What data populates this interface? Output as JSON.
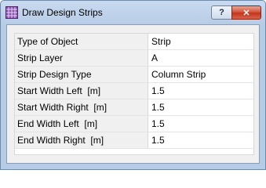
{
  "window": {
    "title": "Draw Design Strips",
    "help_button": "?",
    "close_button": "✕",
    "icon": "grid-app-icon"
  },
  "properties": [
    {
      "label": "Type of Object",
      "value": "Strip"
    },
    {
      "label": "Strip Layer",
      "value": "A"
    },
    {
      "label": "Strip Design Type",
      "value": "Column Strip"
    },
    {
      "label": "Start Width Left  [m]",
      "value": "1.5"
    },
    {
      "label": "Start Width Right  [m]",
      "value": "1.5"
    },
    {
      "label": "End Width Left  [m]",
      "value": "1.5"
    },
    {
      "label": "End Width Right  [m]",
      "value": "1.5"
    }
  ]
}
